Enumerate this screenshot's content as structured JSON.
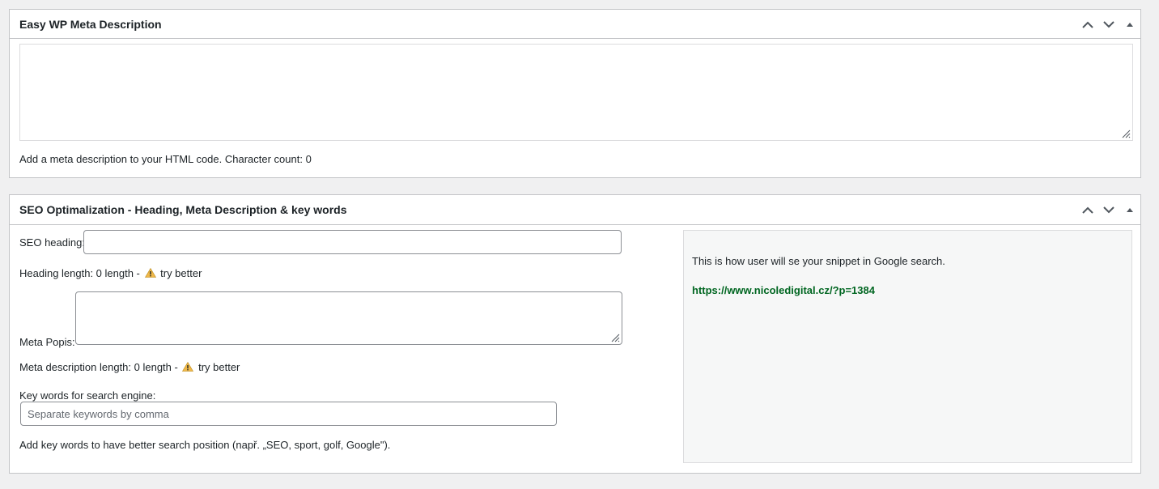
{
  "meta_box": {
    "title": "Easy WP Meta Description",
    "textarea_value": "",
    "help_text": "Add a meta description to your HTML code. Character count: 0"
  },
  "seo_box": {
    "title": "SEO Optimalization - Heading, Meta Description & key words",
    "heading_label": "SEO heading:",
    "heading_value": "",
    "heading_length_text": "Heading length: 0 length - ",
    "heading_warning_text": "try better",
    "meta_label": "Meta Popis:",
    "meta_value": "",
    "meta_length_text": "Meta description length: 0 length - ",
    "meta_warning_text": "try better",
    "keywords_label": "Key words for search engine:",
    "keywords_placeholder": "Separate keywords by comma",
    "keywords_value": "",
    "keywords_help": "Add key words to have better search position (např. „SEO, sport, golf, Google\").",
    "preview": {
      "intro": "This is how user will se your snippet in Google search.",
      "url": "https://www.nicoledigital.cz/?p=1384"
    }
  },
  "icons": {
    "move_up": "chevron-up-icon",
    "move_down": "chevron-down-icon",
    "toggle": "triangle-up-icon",
    "warning": "warning-icon"
  },
  "colors": {
    "background": "#f0f0f1",
    "border": "#c3c4c7",
    "url_green": "#006621",
    "warning_yellow": "#f0b849"
  }
}
